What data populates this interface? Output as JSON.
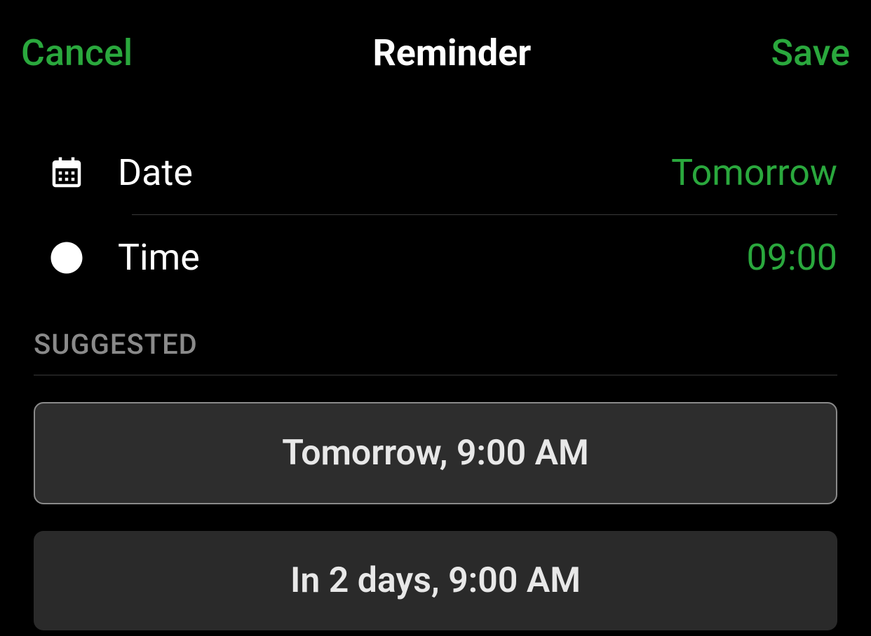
{
  "header": {
    "cancel_label": "Cancel",
    "title": "Reminder",
    "save_label": "Save"
  },
  "rows": {
    "date": {
      "label": "Date",
      "value": "Tomorrow"
    },
    "time": {
      "label": "Time",
      "value": "09:00"
    }
  },
  "suggested": {
    "header": "SUGGESTED",
    "items": [
      {
        "label": "Tomorrow, 9:00 AM",
        "selected": true
      },
      {
        "label": "In 2 days, 9:00 AM",
        "selected": false
      }
    ]
  }
}
